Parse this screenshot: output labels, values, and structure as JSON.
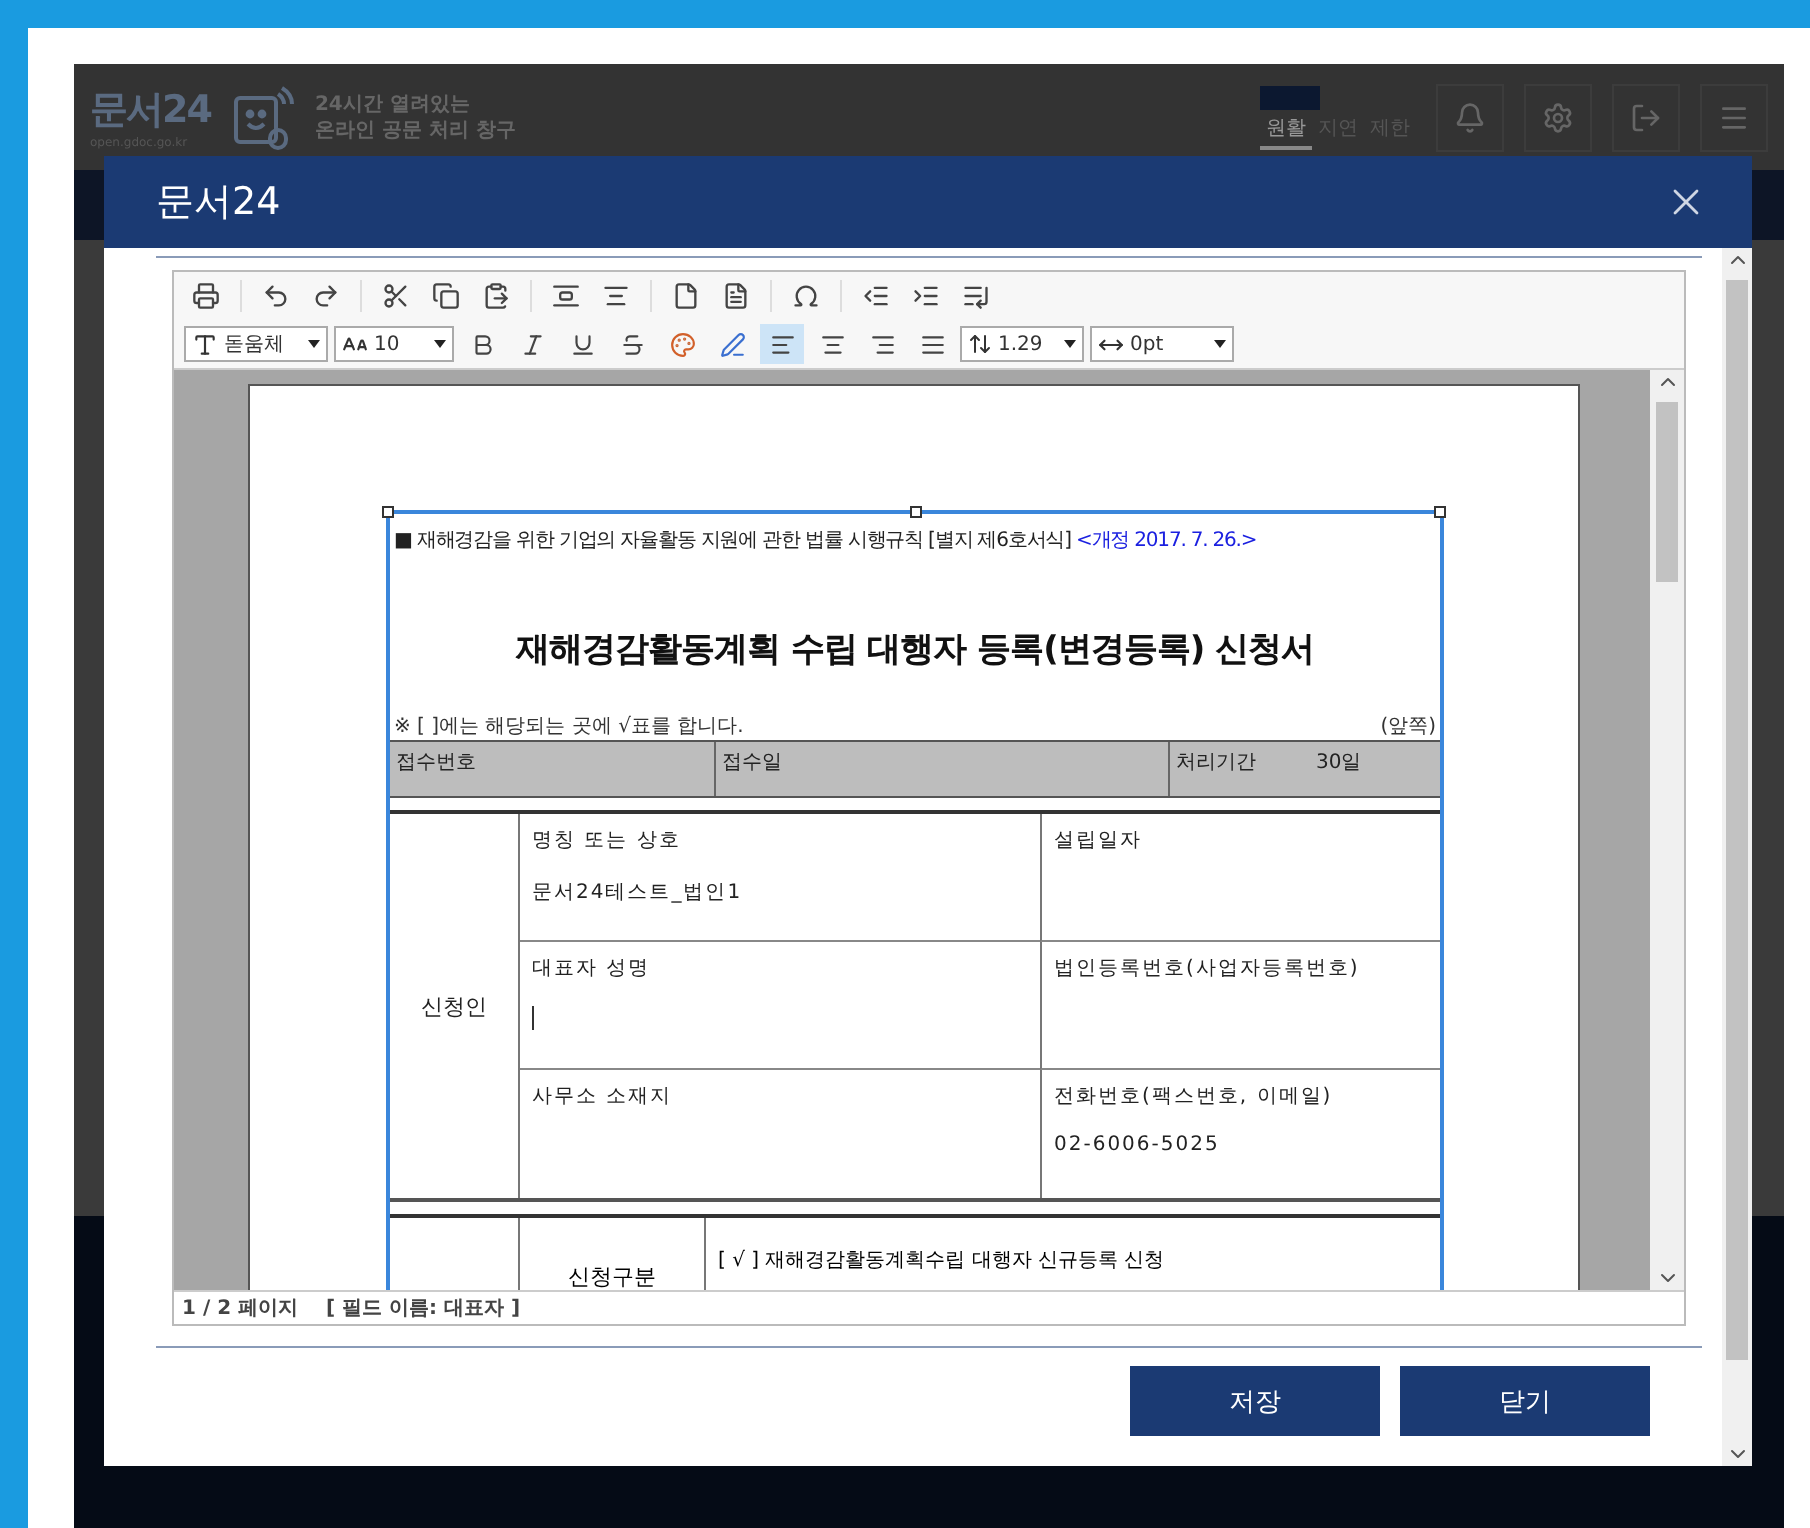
{
  "site_header": {
    "logo": "문서24",
    "logo_url": "open.gdoc.go.kr",
    "tagline_1": "24시간 열려있는",
    "tagline_2": "온라인 공문 처리 창구",
    "status_tabs": [
      {
        "label": "원활",
        "selected": true
      },
      {
        "label": "지연",
        "selected": false
      },
      {
        "label": "제한",
        "selected": false
      }
    ]
  },
  "dialog": {
    "title": "문서24"
  },
  "editor": {
    "font": "돋움체",
    "font_size": "10",
    "line_spacing": "1.29",
    "letter_spacing": "0pt",
    "align_buttons": [
      {
        "selected": true
      },
      {
        "selected": false
      },
      {
        "selected": false
      },
      {
        "selected": false
      }
    ]
  },
  "form": {
    "law_note": "■ 재해경감을 위한 기업의 자율활동 지원에 관한 법률 시행규칙 [별지 제6호서식]",
    "revision": "<개정 2017. 7. 26.>",
    "title": "재해경감활동계획 수립 대행자 등록(변경등록) 신청서",
    "instruction": "※ [  ]에는 해당되는 곳에 √표를 합니다.",
    "page_side": "(앞쪽)",
    "receipt": [
      {
        "label": "접수번호"
      },
      {
        "label": "접수일"
      },
      {
        "label": "처리기간",
        "value": "30일"
      }
    ],
    "applicant": {
      "heading": "신청인",
      "fields": [
        {
          "label": "명칭 또는 상호",
          "value": "문서24테스트_법인1"
        },
        {
          "label": "설립일자"
        },
        {
          "label": "대표자 성명",
          "cursor": true
        },
        {
          "label": "법인등록번호(사업자등록번호)"
        },
        {
          "label": "사무소 소재지"
        },
        {
          "label": "전화번호(팩스번호, 이메일)",
          "value": "02-6006-5025"
        }
      ]
    },
    "application_type": {
      "heading": "신청구분",
      "options": [
        "[ √ ] 재해경감활동계획수립 대행자 신규등록 신청"
      ]
    }
  },
  "status_bar": {
    "page": "1 / 2 페이지",
    "field": "[ 필드 이름: 대표자 ]"
  },
  "buttons": [
    "저장",
    "닫기"
  ]
}
